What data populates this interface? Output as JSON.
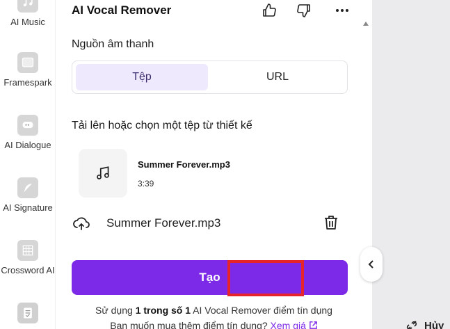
{
  "rail": {
    "items": [
      {
        "label": "AI Music",
        "icon": "music-note-icon"
      },
      {
        "label": "Framespark",
        "icon": "frame-icon"
      },
      {
        "label": "AI Dialogue",
        "icon": "chat-icon"
      },
      {
        "label": "AI Signature",
        "icon": "feather-icon"
      },
      {
        "label": "Crossword AI",
        "icon": "grid-icon"
      },
      {
        "label": "",
        "icon": "checklist-icon"
      }
    ]
  },
  "panel": {
    "title": "AI Vocal Remover",
    "source_label": "Nguồn âm thanh",
    "tabs": [
      {
        "label": "Tệp",
        "active": true
      },
      {
        "label": "URL",
        "active": false
      }
    ],
    "upload_label": "Tải lên hoặc chọn một tệp từ thiết kế",
    "file": {
      "name": "Summer Forever.mp3",
      "duration": "3:39"
    },
    "uploaded_file": "Summer Forever.mp3",
    "create_button": "Tạo",
    "usage": {
      "prefix": "Sử dụng ",
      "bold": "1 trong số 1",
      "suffix": " AI Vocal Remover điểm tín dụng"
    },
    "buy": {
      "text": "Bạn muốn mua thêm điểm tín dụng? ",
      "link": "Xem giá"
    }
  },
  "right": {
    "corner_action": "Hủy"
  },
  "colors": {
    "accent": "#7d2ae8",
    "highlight": "#e5242b",
    "tab_active_bg": "#efe9fd"
  }
}
